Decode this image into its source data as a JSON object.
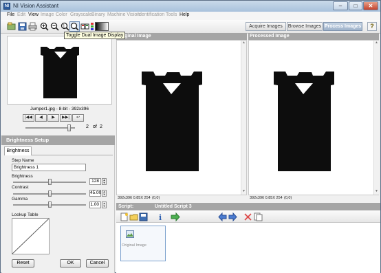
{
  "window": {
    "title": "NI Vision Assistant",
    "icon_text": "NI",
    "controls": {
      "minimize": "–",
      "maximize": "□",
      "close": "✕"
    }
  },
  "menu": {
    "items": [
      {
        "label": "File",
        "enabled": true
      },
      {
        "label": "Edit",
        "enabled": false
      },
      {
        "label": "View",
        "enabled": true
      },
      {
        "label": "Image",
        "enabled": false
      },
      {
        "label": "Color",
        "enabled": false
      },
      {
        "label": "Grayscale",
        "enabled": false
      },
      {
        "label": "Binary",
        "enabled": false
      },
      {
        "label": "Machine Vision",
        "enabled": false
      },
      {
        "label": "Identification",
        "enabled": false
      },
      {
        "label": "Tools",
        "enabled": false
      },
      {
        "label": "Help",
        "enabled": true
      }
    ]
  },
  "toolbar": {
    "tooltip": "Toggle Dual Image Display",
    "icons": [
      "open-image-icon",
      "save-image-icon",
      "print-icon",
      "zoom-in-icon",
      "zoom-out-icon",
      "zoom-1to1-icon",
      "zoom-fit-icon",
      "dual-display-icon",
      "palette-icon",
      "grayscale-ramp-icon"
    ]
  },
  "mode_tabs": {
    "acquire": "Acquire Images",
    "browse": "Browse Images",
    "process": "Process Images",
    "active": "process",
    "help": "?"
  },
  "browser": {
    "caption": "Jumper1.jpg - 8-bit - 392x396",
    "nav": {
      "first": "|◀◀",
      "prev": "◀",
      "next": "▶",
      "last": "▶▶|",
      "return": "↩"
    },
    "page_current": "2",
    "page_of": "of",
    "page_total": "2"
  },
  "setup": {
    "header": "Brightness Setup",
    "tab": "Brightness",
    "step_name_label": "Step Name",
    "step_name_value": "Brightness 1",
    "brightness_label": "Brightness",
    "brightness_value": "128",
    "brightness_level": 0.5,
    "contrast_label": "Contrast",
    "contrast_value": "45.00",
    "contrast_level": 0.5,
    "gamma_label": "Gamma",
    "gamma_value": "1.00",
    "gamma_level": 0.5,
    "lut_label": "Lookup Table",
    "reset": "Reset",
    "ok": "OK",
    "cancel": "Cancel"
  },
  "panels": {
    "original": {
      "title": "Original Image",
      "status": "392x396 0.85X 254",
      "coords": "(0,0)"
    },
    "processed": {
      "title": "Processed Image",
      "status": "392x396 0.85X 254",
      "coords": "(0,0)"
    }
  },
  "script": {
    "label": "Script:",
    "name": "Untitled Script 3",
    "steps": [
      {
        "label": "Original Image"
      }
    ]
  },
  "colors": {
    "accent": "#a5a5a5",
    "active_tab": "#9fb3cb",
    "garment": "#0d0d0d"
  }
}
